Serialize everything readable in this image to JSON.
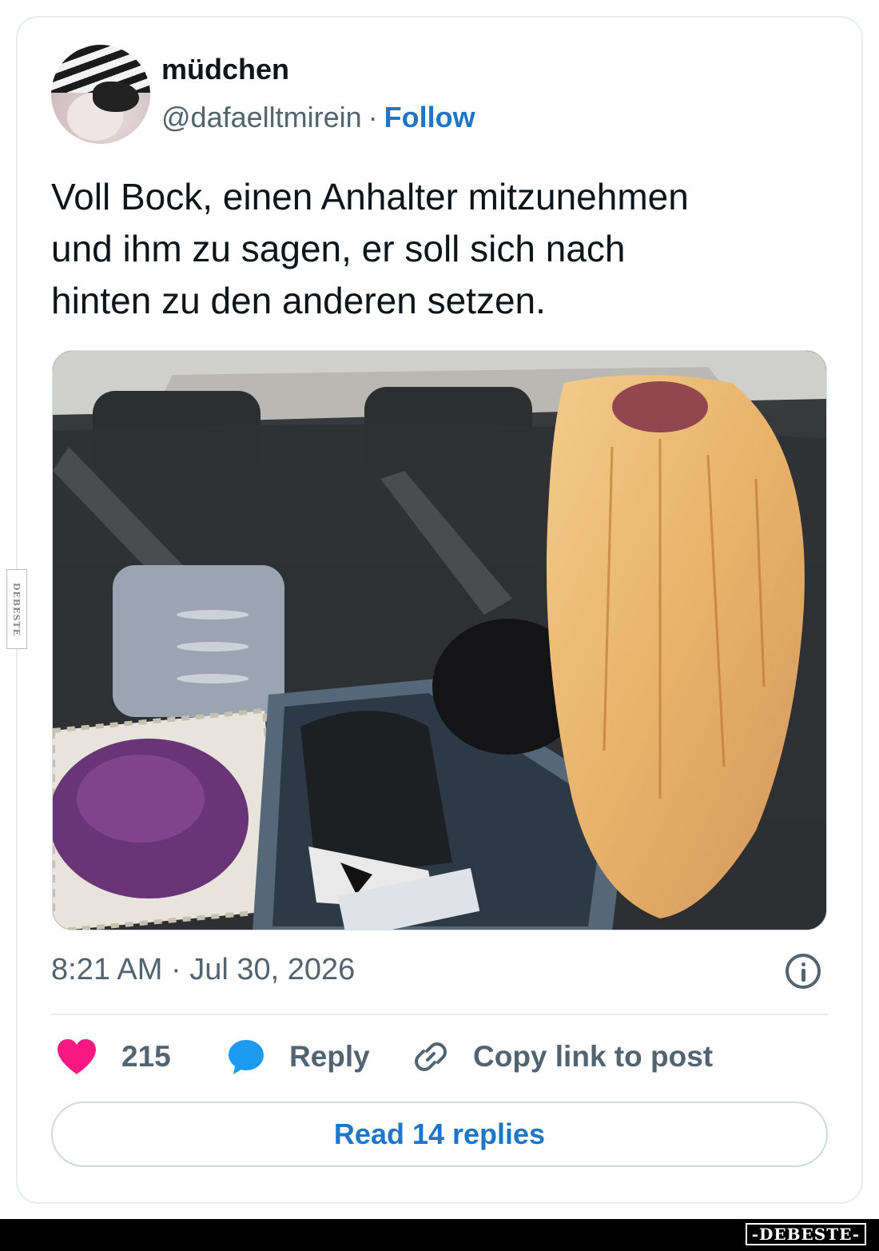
{
  "author": {
    "display_name": "müdchen",
    "handle": "@dafaelltmirein",
    "separator": "·",
    "follow_label": "Follow"
  },
  "tweet": {
    "text": "Voll Bock, einen Anhalter mitzunehmen\nund ihm zu sagen, er soll sich nach\nhinten zu den anderen setzen.",
    "timestamp": "8:21 AM · Jul 30, 2026"
  },
  "actions": {
    "like_count": "215",
    "reply_label": "Reply",
    "copy_link_label": "Copy link to post"
  },
  "read_replies_label": "Read 14 replies",
  "watermark": {
    "side_text": "DEBESTE",
    "footer_text": "-DEBESTE-"
  },
  "colors": {
    "accent_blue": "#1d76c8",
    "like_pink": "#f91880",
    "reply_blue": "#1d9bf0",
    "muted_text": "#536471"
  },
  "icons": {
    "like": "heart-icon",
    "reply": "speech-bubble-icon",
    "copy": "link-icon",
    "info": "info-icon"
  }
}
